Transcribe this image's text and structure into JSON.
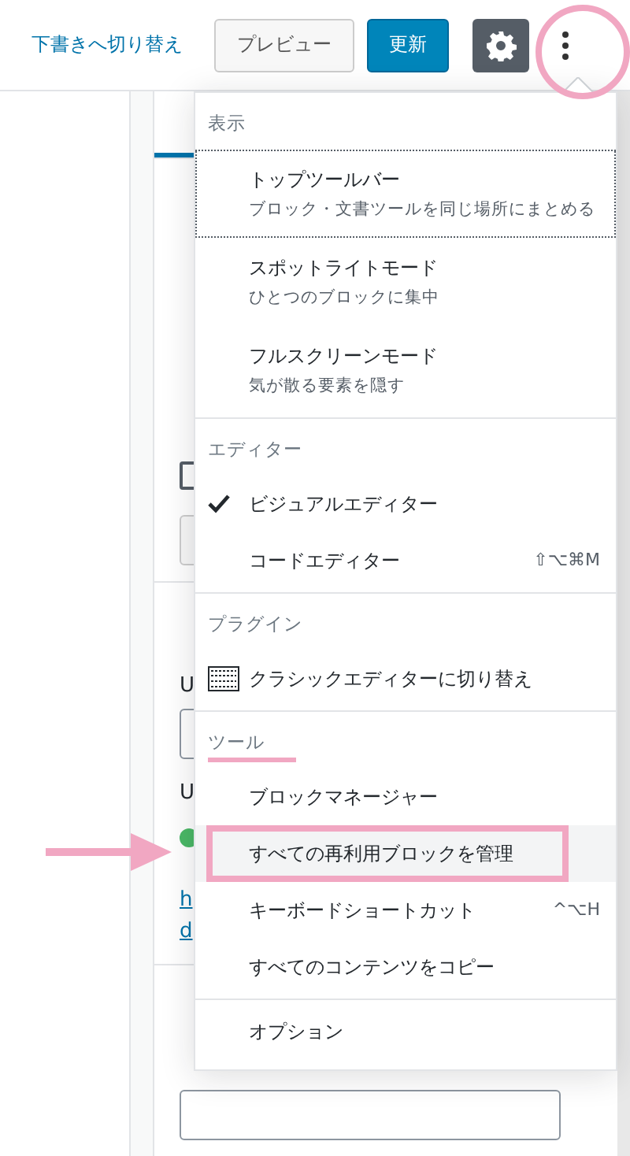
{
  "header": {
    "draft_link": "下書きへ切り替え",
    "preview_button": "プレビュー",
    "update_button": "更新",
    "settings_button": {
      "active": true
    },
    "more_button": {
      "annotated": true
    }
  },
  "sidebar": {
    "tab": {
      "selected": true
    },
    "panels": [
      {
        "items": [
          {
            "kind": "checkbox",
            "checked": false
          },
          {
            "kind": "button"
          }
        ]
      },
      {
        "items": [
          {
            "kind": "text",
            "text": "U"
          },
          {
            "kind": "field"
          },
          {
            "kind": "text",
            "text": "U"
          },
          {
            "kind": "status"
          },
          {
            "kind": "link",
            "text": "h"
          },
          {
            "kind": "link",
            "text": "d"
          }
        ]
      },
      {
        "items": [
          {
            "kind": "field"
          }
        ]
      }
    ]
  },
  "menu": {
    "sections": [
      {
        "title": "表示",
        "annotated": false,
        "items": [
          {
            "kind": "toggle",
            "label": "トップツールバー",
            "description": "ブロック・文書ツールを同じ場所にまとめる",
            "focused": true,
            "checked": false,
            "hovered": false,
            "annotated": false
          },
          {
            "kind": "toggle",
            "label": "スポットライトモード",
            "description": "ひとつのブロックに集中",
            "focused": false,
            "checked": false,
            "hovered": false,
            "annotated": false
          },
          {
            "kind": "toggle",
            "label": "フルスクリーンモード",
            "description": "気が散る要素を隠す",
            "focused": false,
            "checked": false,
            "hovered": false,
            "annotated": false
          }
        ]
      },
      {
        "title": "エディター",
        "annotated": false,
        "items": [
          {
            "kind": "toggle",
            "label": "ビジュアルエディター",
            "focused": false,
            "checked": true,
            "hovered": false,
            "annotated": false
          },
          {
            "kind": "toggle",
            "label": "コードエディター",
            "shortcut": "⇧⌥⌘M",
            "focused": false,
            "checked": false,
            "hovered": false,
            "annotated": false
          }
        ]
      },
      {
        "title": "プラグイン",
        "annotated": false,
        "items": [
          {
            "kind": "plugin",
            "label": "クラシックエディターに切り替え",
            "focused": false,
            "checked": false,
            "hovered": false,
            "annotated": false
          }
        ]
      },
      {
        "title": "ツール",
        "annotated": true,
        "items": [
          {
            "kind": "toggle",
            "label": "ブロックマネージャー",
            "focused": false,
            "checked": false,
            "hovered": false,
            "annotated": false
          },
          {
            "kind": "toggle",
            "label": "すべての再利用ブロックを管理",
            "focused": false,
            "checked": false,
            "hovered": true,
            "annotated": true
          },
          {
            "kind": "toggle",
            "label": "キーボードショートカット",
            "shortcut": "^⌥H",
            "focused": false,
            "checked": false,
            "hovered": false,
            "annotated": false
          },
          {
            "kind": "toggle",
            "label": "すべてのコンテンツをコピー",
            "focused": false,
            "checked": false,
            "hovered": false,
            "annotated": false
          }
        ]
      },
      {
        "items": [
          {
            "kind": "toggle",
            "label": "オプション",
            "focused": false,
            "checked": false,
            "hovered": false,
            "annotated": false
          }
        ]
      }
    ]
  }
}
